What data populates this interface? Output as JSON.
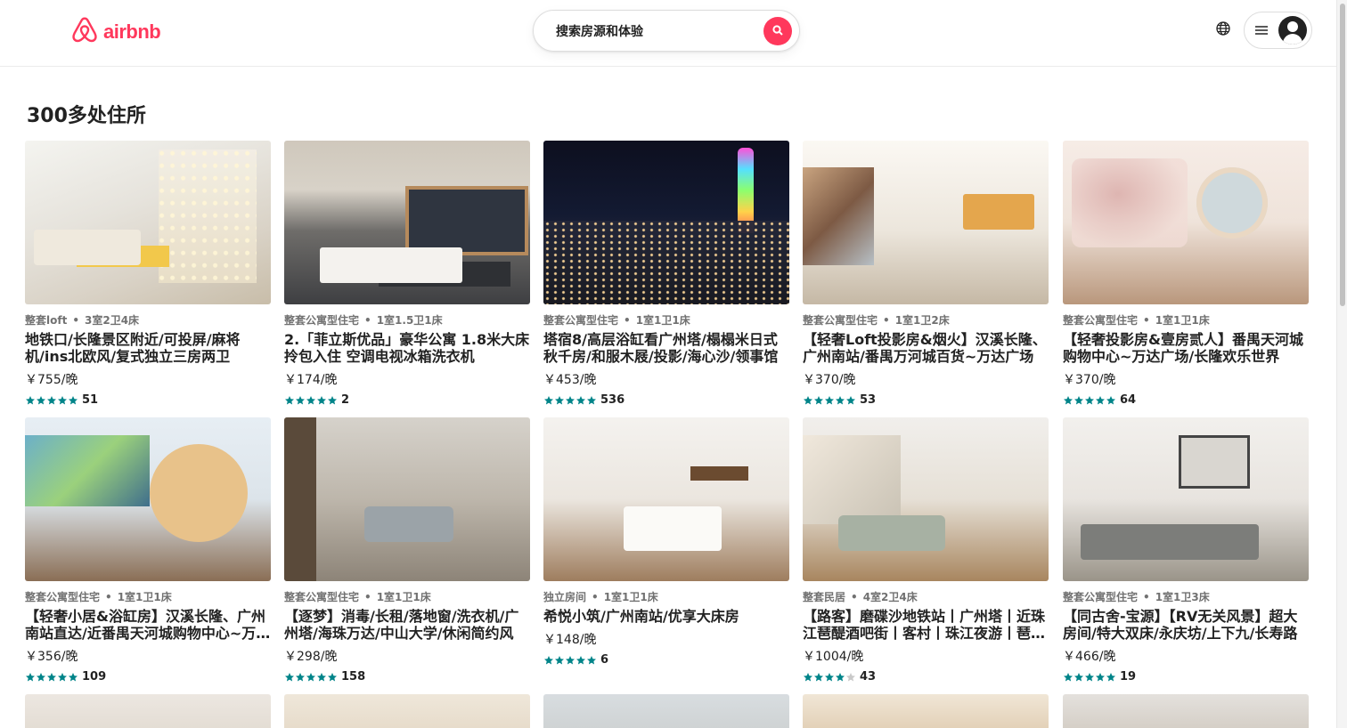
{
  "brand": {
    "name": "airbnb",
    "color": "#ff385c"
  },
  "search": {
    "placeholder": "搜索房源和体验"
  },
  "results": {
    "title": "300多处住所"
  },
  "listings": [
    {
      "type": "整套loft",
      "details": "3室2卫4床",
      "name": "地铁口/长隆景区附近/可投屏/麻将机/ins北欧风/复式独立三房两卫",
      "price": "￥755/晚",
      "rating_count": "51",
      "stars": 5
    },
    {
      "type": "整套公寓型住宅",
      "details": "1室1.5卫1床",
      "name": "2.「菲立斯优品」豪华公寓 1.8米大床拎包入住 空调电视冰箱洗衣机",
      "price": "￥174/晚",
      "rating_count": "2",
      "stars": 5
    },
    {
      "type": "整套公寓型住宅",
      "details": "1室1卫1床",
      "name": "塔宿8/高层浴缸看广州塔/榻榻米日式秋千房/和服木屐/投影/海心沙/领事馆",
      "price": "￥453/晚",
      "rating_count": "536",
      "stars": 5
    },
    {
      "type": "整套公寓型住宅",
      "details": "1室1卫2床",
      "name": "【轻奢Loft投影房&烟火】汉溪长隆、广州南站/番禺万河城百货~万达广场",
      "price": "￥370/晚",
      "rating_count": "53",
      "stars": 5
    },
    {
      "type": "整套公寓型住宅",
      "details": "1室1卫1床",
      "name": "【轻奢投影房&壹房贰人】番禺天河城购物中心~万达广场/长隆欢乐世界",
      "price": "￥370/晚",
      "rating_count": "64",
      "stars": 5
    },
    {
      "type": "整套公寓型住宅",
      "details": "1室1卫1床",
      "name": "【轻奢小居&浴缸房】汉溪长隆、广州南站直达/近番禺天河城购物中心~万达广场",
      "price": "￥356/晚",
      "rating_count": "109",
      "stars": 5
    },
    {
      "type": "整套公寓型住宅",
      "details": "1室1卫1床",
      "name": "【逐梦】消毒/长租/落地窗/洗衣机/广州塔/海珠万达/中山大学/休闲简约风",
      "price": "￥298/晚",
      "rating_count": "158",
      "stars": 5
    },
    {
      "type": "独立房间",
      "details": "1室1卫1床",
      "name": "希悦小筑/广州南站/优享大床房",
      "price": "￥148/晚",
      "rating_count": "6",
      "stars": 5
    },
    {
      "type": "整套民居",
      "details": "4室2卫4床",
      "name": "【路客】磨碟沙地铁站丨广州塔丨近珠江琶醍酒吧街丨客村丨珠江夜游丨琶洲会展",
      "price": "￥1004/晚",
      "rating_count": "43",
      "stars": 4
    },
    {
      "type": "整套公寓型住宅",
      "details": "1室1卫3床",
      "name": "【同古舍-宝源】【RV无关风景】超大房间/特大双床/永庆坊/上下九/长寿路",
      "price": "￥466/晚",
      "rating_count": "19",
      "stars": 5
    }
  ],
  "colors": {
    "star": "#008489",
    "star_empty": "#c9c9c9",
    "text": "#222222",
    "muted": "#717171"
  },
  "icons": {
    "search": "search-icon",
    "globe": "globe-icon",
    "menu": "hamburger-menu-icon",
    "user": "user-avatar-icon"
  }
}
